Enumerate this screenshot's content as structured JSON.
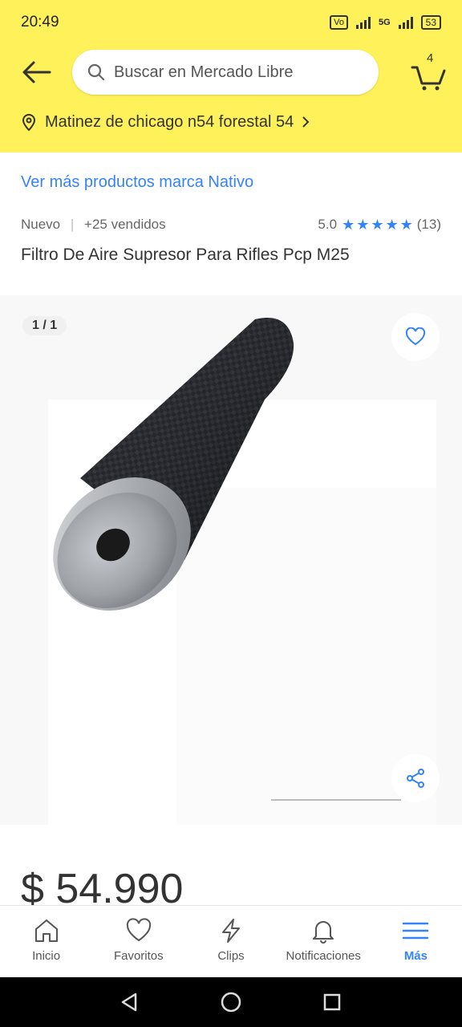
{
  "status": {
    "time": "20:49",
    "volte": "VoLTE",
    "network": "5G",
    "battery": "53"
  },
  "header": {
    "search_placeholder": "Buscar en Mercado Libre",
    "cart_count": "4",
    "location": "Matinez de chicago n54 forestal 54"
  },
  "product": {
    "brand_link": "Ver más productos marca Nativo",
    "condition": "Nuevo",
    "sold": "+25 vendidos",
    "rating_value": "5.0",
    "rating_count": "(13)",
    "stars": 5,
    "title": "Filtro De Aire Supresor Para Rifles Pcp M25",
    "image_counter": "1 / 1",
    "price": "$ 54.990"
  },
  "tabs": [
    {
      "label": "Inicio",
      "icon": "home-icon"
    },
    {
      "label": "Favoritos",
      "icon": "heart-icon"
    },
    {
      "label": "Clips",
      "icon": "lightning-icon"
    },
    {
      "label": "Notificaciones",
      "icon": "bell-icon"
    },
    {
      "label": "Más",
      "icon": "menu-icon"
    }
  ],
  "colors": {
    "brand_yellow": "#fff159",
    "accent_blue": "#3483fa"
  }
}
